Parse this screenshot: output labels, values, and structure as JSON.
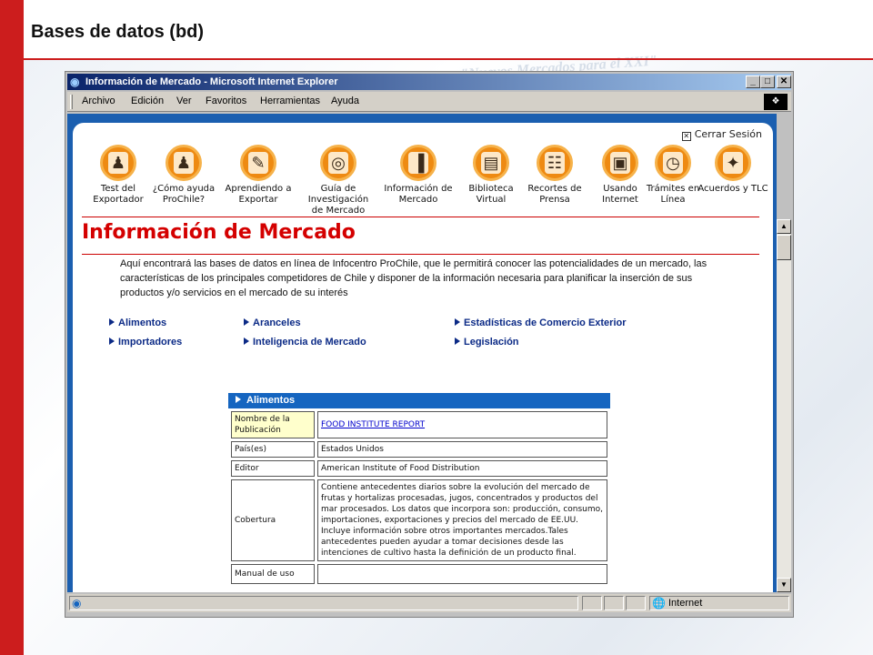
{
  "slide": {
    "title": "Bases de datos (bd)"
  },
  "colors": {
    "accent_red": "#cc1d1d",
    "site_blue": "#1565c0",
    "nav_orange": "#ee8a12"
  },
  "window": {
    "title": "Información de Mercado - Microsoft Internet Explorer",
    "buttons": {
      "minimize": "_",
      "maximize": "□",
      "close": "✕"
    },
    "menu": [
      "Archivo",
      "Edición",
      "Ver",
      "Favoritos",
      "Herramientas",
      "Ayuda"
    ],
    "status": {
      "zone": "Internet"
    }
  },
  "site": {
    "logout": "Cerrar Sesión",
    "nav": [
      {
        "label": "Test del Exportador",
        "icon": "businessman-red-tie-icon"
      },
      {
        "label": "¿Cómo ayuda ProChile?",
        "icon": "businessman-suit-icon"
      },
      {
        "label": "Aprendiendo a Exportar",
        "icon": "reading-man-icon"
      },
      {
        "label": "Guía de Investigación de Mercado",
        "icon": "globe-icon"
      },
      {
        "label": "Información de Mercado",
        "icon": "bar-chart-icon"
      },
      {
        "label": "Biblioteca Virtual",
        "icon": "books-icon"
      },
      {
        "label": "Recortes de Prensa",
        "icon": "newspaper-icon"
      },
      {
        "label": "Usando Internet",
        "icon": "computer-icon"
      },
      {
        "label": "Trámites en Línea",
        "icon": "stopwatch-icon"
      },
      {
        "label": "Acuerdos y TLC",
        "icon": "handshake-icon"
      }
    ],
    "heading": "Información de Mercado",
    "intro": "Aquí encontrará las bases de datos en línea de Infocentro ProChile, que le permitirá conocer las potencialidades de un mercado, las características de los principales competidores de Chile y disponer de la información necesaria para planificar la inserción de sus productos y/o servicios en el mercado de su interés",
    "categories": [
      "Alimentos",
      "Aranceles",
      "Estadísticas de Comercio Exterior",
      "Importadores",
      "Inteligencia de Mercado",
      "Legislación"
    ],
    "table": {
      "header": "Alimentos",
      "rows": [
        {
          "key": "Nombre de la Publicación",
          "value": "FOOD INSTITUTE REPORT"
        },
        {
          "key": "País(es)",
          "value": "Estados Unidos"
        },
        {
          "key": "Editor",
          "value": "American Institute of Food Distribution"
        },
        {
          "key": "Cobertura",
          "value": "Contiene antecedentes diarios sobre la evolución del mercado de frutas y hortalizas procesadas, jugos, concentrados y productos del mar procesados. Los datos que incorpora son: producción, consumo, importaciones, exportaciones y precios del mercado de EE.UU. Incluye información sobre otros importantes mercados.Tales antecedentes pueden ayudar a tomar decisiones desde las intenciones de cultivo hasta la definición de un producto final."
        },
        {
          "key": "Manual de uso",
          "value": ""
        }
      ]
    }
  }
}
